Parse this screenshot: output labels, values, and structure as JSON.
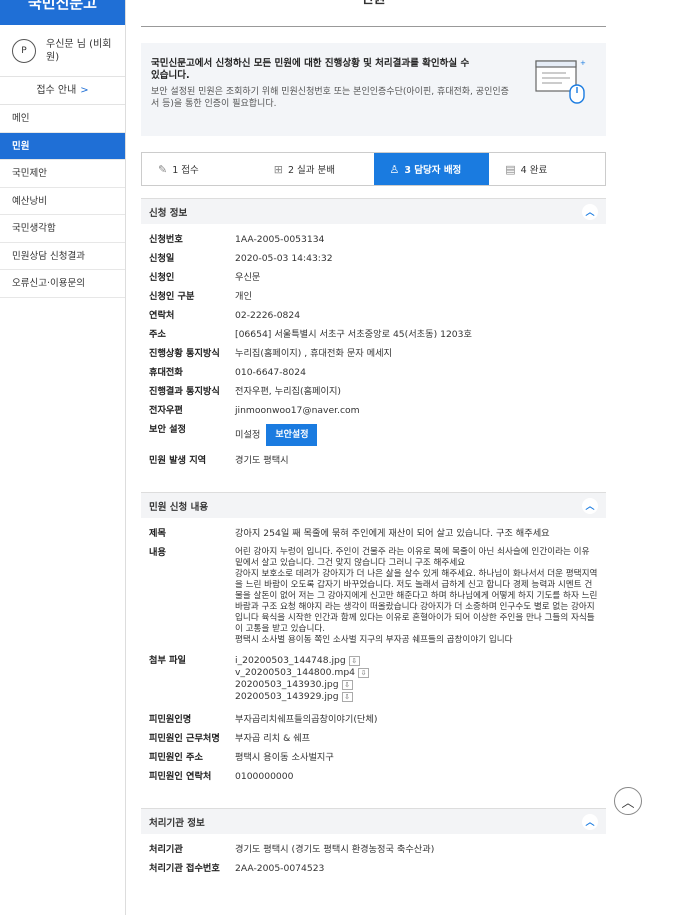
{
  "sidebar": {
    "header": "국민신문고",
    "user_icon": "P",
    "user_name": "우신문 님 (비회원)",
    "guide": "접수 안내",
    "guide_arrow": ">",
    "items": [
      "메인",
      "민원",
      "국민제안",
      "예산낭비",
      "국민생각함",
      "민원상담 신청결과",
      "오류신고·이용문의"
    ]
  },
  "page": {
    "title": "민원"
  },
  "info": {
    "text1": "국민신문고에서 신청하신 모든 민원에 대한 진행상황 및 처리결과를 확인하실 수 있습니다.",
    "text2": "보안 설정된 민원은 조회하기 위해 민원신청번호 또는 본인인증수단(아이핀, 휴대전화, 공인인증서 등)을 통한 인증이 필요합니다."
  },
  "steps": [
    {
      "label": "1 접수",
      "icon": "pencil-icon"
    },
    {
      "label": "2 실과 분배",
      "icon": "org-icon"
    },
    {
      "label": "3 담당자 배정",
      "icon": "person-icon"
    },
    {
      "label": "4 완료",
      "icon": "doc-check-icon"
    }
  ],
  "apply": {
    "header": "신청 정보",
    "rows": [
      {
        "label": "신청번호",
        "value": "1AA-2005-0053134"
      },
      {
        "label": "신청일",
        "value": "2020-05-03 14:43:32"
      },
      {
        "label": "신청인",
        "value": "우신문"
      },
      {
        "label": "신청인 구분",
        "value": "개인"
      },
      {
        "label": "연락처",
        "value": "02-2226-0824"
      },
      {
        "label": "주소",
        "value": "[06654] 서울특별시 서초구 서초중앙로 45(서초동) 1203호"
      },
      {
        "label": "진행상황 통지방식",
        "value": "누리집(홈페이지) , 휴대전화 문자 메세지"
      },
      {
        "label": "휴대전화",
        "value": "010-6647-8024"
      },
      {
        "label": "진행결과 통지방식",
        "value": "전자우편, 누리집(홈페이지)"
      },
      {
        "label": "전자우편",
        "value": "jinmoonwoo17@naver.com"
      }
    ],
    "security_label": "보안 설정",
    "security_value": "미설정",
    "security_button": "보안설정",
    "region_label": "민원 발생 지역",
    "region_value": "경기도 평택시"
  },
  "content": {
    "header": "민원 신청 내용",
    "subject_label": "제목",
    "subject": "강아지 254일 째 목줄에 묶혀 주인에게 재산이 되어 살고 있습니다. 구조 해주세요",
    "body_label": "내용",
    "body": "어린 강아지 누렁이 입니다. 주인이 건물주 라는 이유로 목에 목줄이 아닌 쇠사슬에 인간이라는 이유 밑에서 살고 있습니다. 그건 맞지 않습니다 그러니 구조 해주세요\n강아지 보호소로 데려가 강아지가 더 나은 삶을 살수 있게 해주세요. 하나님이 화나서서 더운 평택지역을 느린 바람이 오도록 갑자기 바꾸었습니다. 저도 놀래서 급하게 신고 합니다 경제 능력과 시멘트 건물을 살돈이 없어 저는 그 강아지에게 신고만 해준다고 하며 하나님에게 어떻게 하지 기도를 하자 느린 바람과 구조 요청 해야지 라는 생각이 떠올랐습니다 강아지가 더 소중하며 인구수도 별로 없는 강아지 입니다 육식을 시작한 인간과 함께 있다는 이유로 혼혈아이가 되어 이상한 주인을 만나 그들의 자식들이 고통을 받고 있습니다.\n평택시 소사벌 용이동 쪽인 소사벌 지구의 부자공 쉐프들의 곱창이야기 입니다",
    "files_label": "첨부 파일",
    "files": [
      "i_20200503_144748.jpg",
      "v_20200503_144800.mp4",
      "20200503_143930.jpg",
      "20200503_143929.jpg"
    ],
    "download_icon": "download-icon",
    "rows": [
      {
        "label": "피민원인명",
        "value": "부자곱리치쉐프들의곱창이야기(단체)"
      },
      {
        "label": "피민원인 근무처명",
        "value": "부자곱 리치 & 쉐프"
      },
      {
        "label": "피민원인 주소",
        "value": "평택시 용이동 소사벌지구"
      },
      {
        "label": "피민원인 연락처",
        "value": "0100000000"
      }
    ]
  },
  "agency": {
    "header": "처리기관 정보",
    "rows": [
      {
        "label": "처리기관",
        "value": "경기도 평택시 (경기도 평택시 환경농정국 축수산과)"
      },
      {
        "label": "처리기관 접수번호",
        "value": "2AA-2005-0074523"
      }
    ]
  },
  "colors": {
    "primary": "#1a7be0",
    "sidebar_active": "#1f6fd6"
  }
}
